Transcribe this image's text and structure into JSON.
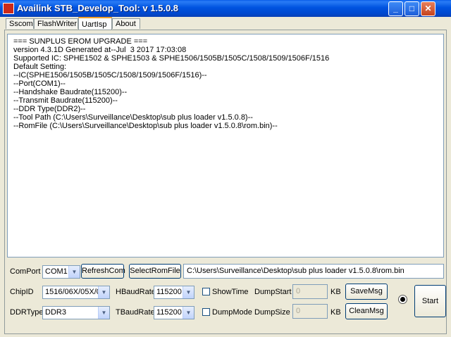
{
  "window": {
    "title": "Availink STB_Develop_Tool: v 1.5.0.8",
    "minimize": "_",
    "maximize": "□",
    "close": "✕"
  },
  "tabs": [
    {
      "label": "Sscom"
    },
    {
      "label": "FlashWriter"
    },
    {
      "label": "UartIsp",
      "active": true
    },
    {
      "label": "About"
    }
  ],
  "log": {
    "lines": [
      "=== SUNPLUS EROM UPGRADE ===",
      "version 4.3.1D Generated at--Jul  3 2017 17:03:08",
      "Supported IC: SPHE1502 & SPHE1503 & SPHE1506/1505B/1505C/1508/1509/1506F/1516",
      "Default Setting:",
      "--IC(SPHE1506/1505B/1505C/1508/1509/1506F/1516)--",
      "--Port(COM1)--",
      "--Handshake Baudrate(115200)--",
      "--Transmit Baudrate(115200)--",
      "--DDR Type(DDR2)--",
      "--Tool Path (C:\\Users\\Surveillance\\Desktop\\sub plus loader v1.5.0.8)--",
      "--RomFile (C:\\Users\\Surveillance\\Desktop\\sub plus loader v1.5.0.8\\rom.bin)--"
    ]
  },
  "controls": {
    "comport_label": "ComPort",
    "comport_value": "COM1",
    "refreshcom_label": "RefreshCom",
    "selectromfile_label": "SelectRomFile",
    "romfile_path": "C:\\Users\\Surveillance\\Desktop\\sub plus loader v1.5.0.8\\rom.bin",
    "chipid_label": "ChipID",
    "chipid_value": "1516/06X/05X/0",
    "hbaudrate_label": "HBaudRate",
    "hbaudrate_value": "115200",
    "showtime_label": "ShowTime",
    "dumpstart_label": "DumpStart",
    "dumpstart_value": "0",
    "dumpstart_unit": "KB",
    "savemsg_label": "SaveMsg",
    "ddrtype_label": "DDRType",
    "ddrtype_value": "DDR3",
    "tbaudrate_label": "TBaudRate",
    "tbaudrate_value": "115200",
    "dumpmode_label": "DumpMode",
    "dumpsize_label": "DumpSize",
    "dumpsize_value": "0",
    "dumpsize_unit": "KB",
    "cleanmsg_label": "CleanMsg",
    "start_label": "Start"
  }
}
